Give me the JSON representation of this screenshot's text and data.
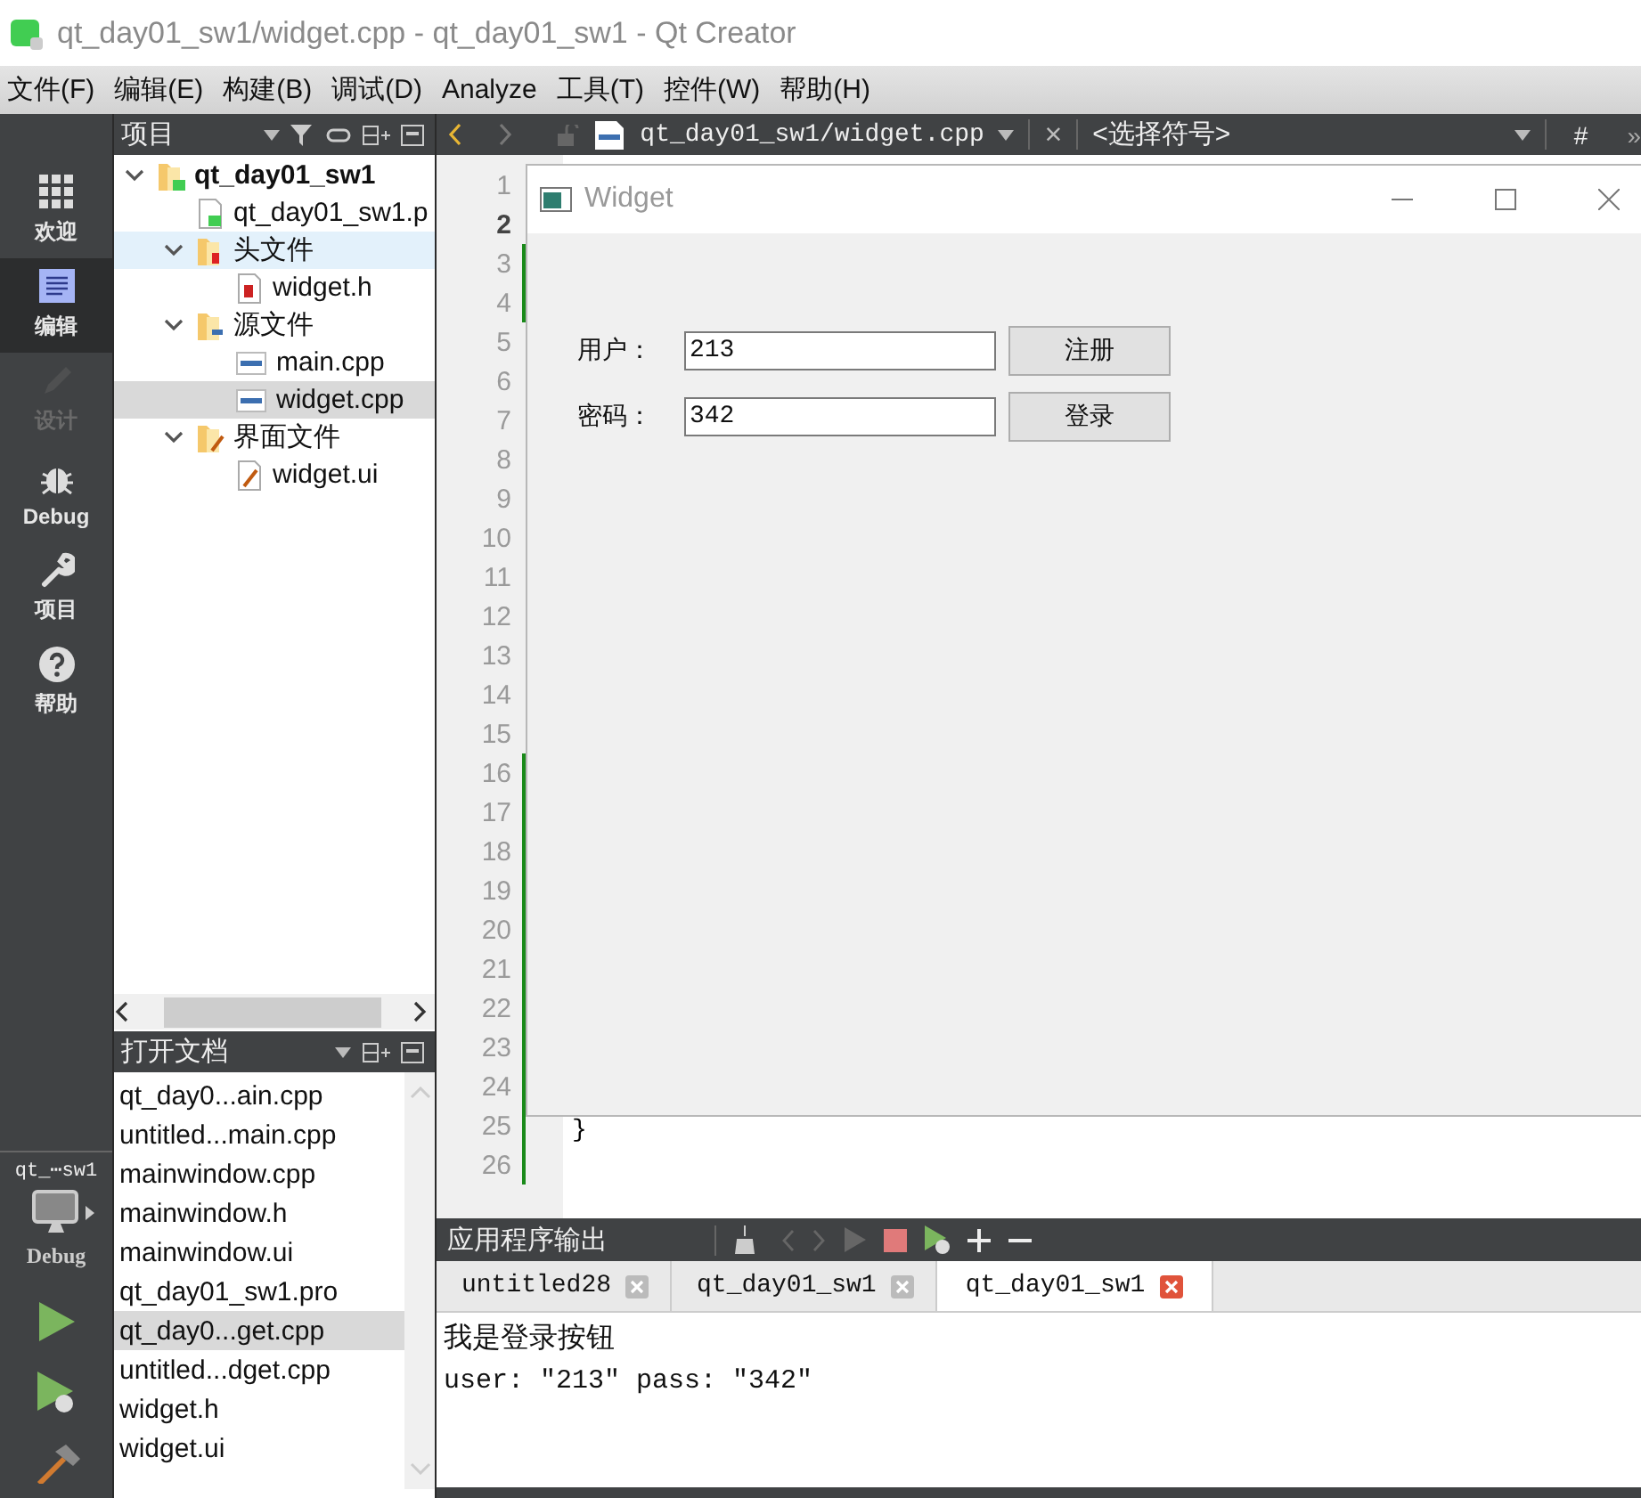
{
  "window": {
    "title": "qt_day01_sw1/widget.cpp - qt_day01_sw1 - Qt Creator"
  },
  "menu": [
    "文件(F)",
    "编辑(E)",
    "构建(B)",
    "调试(D)",
    "Analyze",
    "工具(T)",
    "控件(W)",
    "帮助(H)"
  ],
  "modes": [
    {
      "label": "欢迎",
      "selected": false,
      "disabled": false
    },
    {
      "label": "编辑",
      "selected": true,
      "disabled": false
    },
    {
      "label": "设计",
      "selected": false,
      "disabled": true
    },
    {
      "label": "Debug",
      "selected": false,
      "disabled": false
    },
    {
      "label": "项目",
      "selected": false,
      "disabled": false
    },
    {
      "label": "帮助",
      "selected": false,
      "disabled": false
    }
  ],
  "kit": {
    "project": "qt_⋯sw1",
    "build": "Debug"
  },
  "project_panel": {
    "title": "项目",
    "tree": [
      {
        "label": "qt_day01_sw1",
        "kind": "project",
        "expanded": true,
        "selected": false,
        "hovered": false,
        "children": [
          {
            "label": "qt_day01_sw1.p",
            "kind": "pro",
            "selected": false,
            "hovered": false
          },
          {
            "label": "头文件",
            "kind": "header-folder",
            "expanded": true,
            "selected": false,
            "hovered": true,
            "children": [
              {
                "label": "widget.h",
                "kind": "header",
                "selected": false,
                "hovered": false
              }
            ]
          },
          {
            "label": "源文件",
            "kind": "source-folder",
            "expanded": true,
            "selected": false,
            "hovered": false,
            "children": [
              {
                "label": "main.cpp",
                "kind": "source",
                "selected": false,
                "hovered": false
              },
              {
                "label": "widget.cpp",
                "kind": "source",
                "selected": true,
                "hovered": false
              }
            ]
          },
          {
            "label": "界面文件",
            "kind": "form-folder",
            "expanded": true,
            "selected": false,
            "hovered": false,
            "children": [
              {
                "label": "widget.ui",
                "kind": "form",
                "selected": false,
                "hovered": false
              }
            ]
          }
        ]
      }
    ]
  },
  "open_documents": {
    "title": "打开文档",
    "items": [
      {
        "label": "qt_day0...ain.cpp",
        "selected": false
      },
      {
        "label": "untitled...main.cpp",
        "selected": false
      },
      {
        "label": "mainwindow.cpp",
        "selected": false
      },
      {
        "label": "mainwindow.h",
        "selected": false
      },
      {
        "label": "mainwindow.ui",
        "selected": false
      },
      {
        "label": "qt_day01_sw1.pro",
        "selected": false
      },
      {
        "label": "qt_day0...get.cpp",
        "selected": true
      },
      {
        "label": "untitled...dget.cpp",
        "selected": false
      },
      {
        "label": "widget.h",
        "selected": false
      },
      {
        "label": "widget.ui",
        "selected": false
      }
    ]
  },
  "editor": {
    "file": "qt_day01_sw1/widget.cpp",
    "close": "×",
    "symbol": "<选择符号>",
    "hash": "#",
    "more": "»",
    "lines": [
      {
        "number": "1",
        "current": false,
        "changed": false
      },
      {
        "number": "2",
        "current": true,
        "changed": false
      },
      {
        "number": "3",
        "current": false,
        "changed": true
      },
      {
        "number": "4",
        "current": false,
        "changed": true
      },
      {
        "number": "5",
        "current": false,
        "changed": false
      },
      {
        "number": "6",
        "current": false,
        "changed": false
      },
      {
        "number": "7",
        "current": false,
        "changed": false
      },
      {
        "number": "8",
        "current": false,
        "changed": false
      },
      {
        "number": "9",
        "current": false,
        "changed": false
      },
      {
        "number": "10",
        "current": false,
        "changed": false
      },
      {
        "number": "11",
        "current": false,
        "changed": false
      },
      {
        "number": "12",
        "current": false,
        "changed": false
      },
      {
        "number": "13",
        "current": false,
        "changed": false
      },
      {
        "number": "14",
        "current": false,
        "changed": false
      },
      {
        "number": "15",
        "current": false,
        "changed": false
      },
      {
        "number": "16",
        "current": false,
        "changed": true
      },
      {
        "number": "17",
        "current": false,
        "changed": true
      },
      {
        "number": "18",
        "current": false,
        "changed": true
      },
      {
        "number": "19",
        "current": false,
        "changed": true
      },
      {
        "number": "20",
        "current": false,
        "changed": true
      },
      {
        "number": "21",
        "current": false,
        "changed": true
      },
      {
        "number": "22",
        "current": false,
        "changed": true
      },
      {
        "number": "23",
        "current": false,
        "changed": true
      },
      {
        "number": "24",
        "current": false,
        "changed": true
      },
      {
        "number": "25",
        "current": false,
        "changed": true,
        "code": "}"
      },
      {
        "number": "26",
        "current": false,
        "changed": true
      }
    ]
  },
  "app_window": {
    "title": "Widget",
    "rows": [
      {
        "label": "用户：",
        "value": "213",
        "button": "注册"
      },
      {
        "label": "密码：",
        "value": "342",
        "button": "登录"
      }
    ]
  },
  "output": {
    "title": "应用程序输出",
    "tabs": [
      {
        "label": "untitled28",
        "selected": false
      },
      {
        "label": "qt_day01_sw1",
        "selected": false
      },
      {
        "label": "qt_day01_sw1",
        "selected": true
      }
    ],
    "lines": [
      "我是登录按钮",
      "user: \"213\" pass: \"342\""
    ]
  }
}
